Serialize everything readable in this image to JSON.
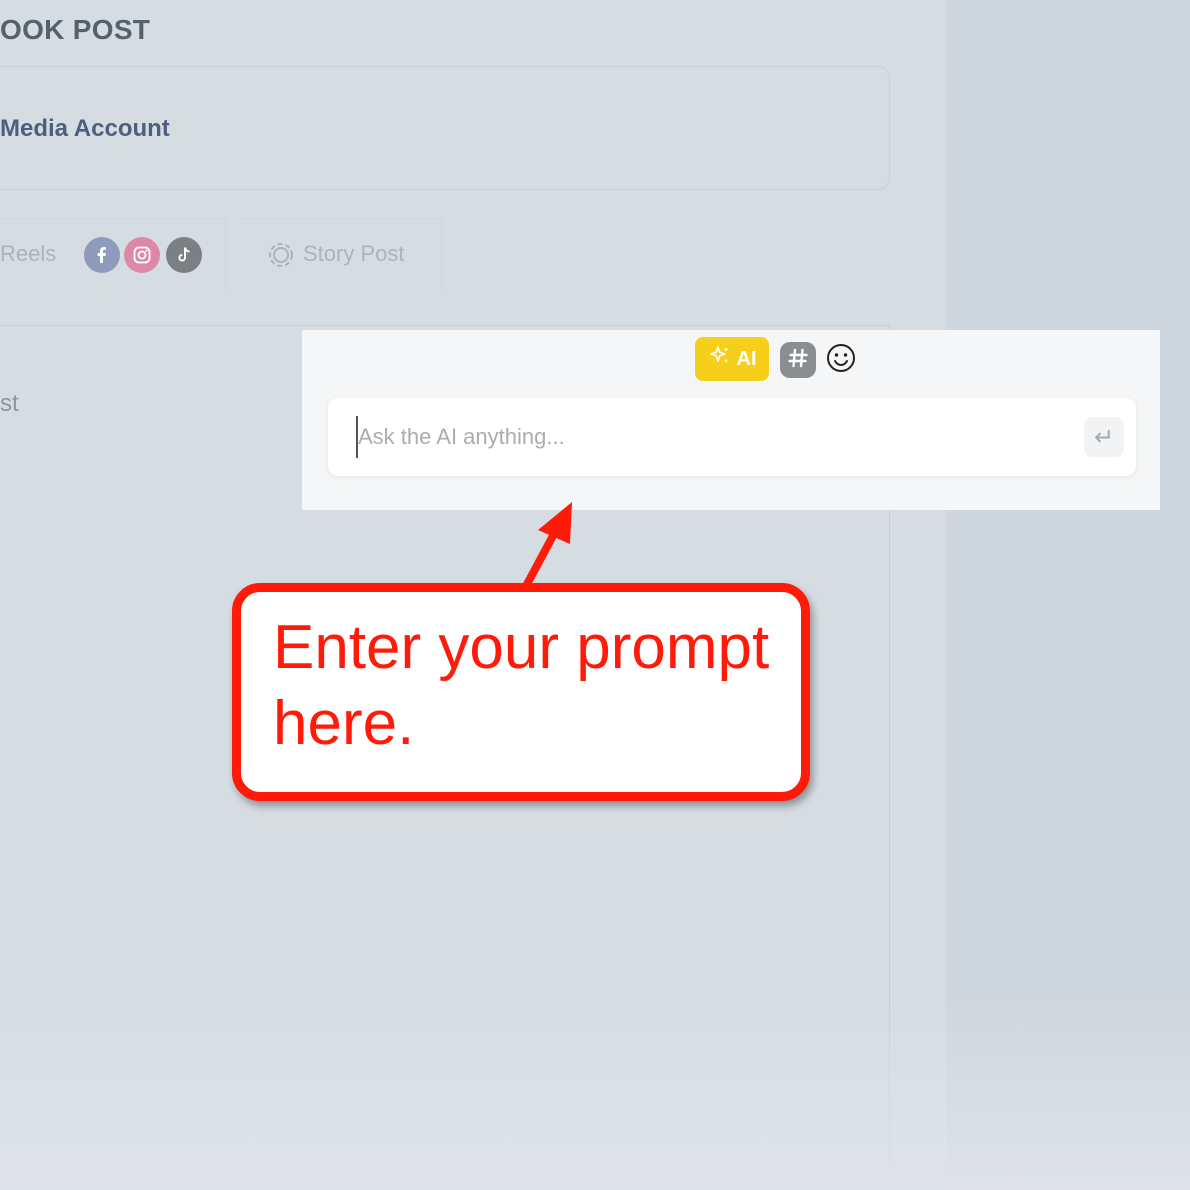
{
  "header": {
    "title": "OOK POST"
  },
  "account": {
    "label": "Media Account"
  },
  "tabs": {
    "reels_label": "Reels",
    "reels_icons": [
      "facebook-icon",
      "instagram-icon",
      "tiktok-icon"
    ],
    "story_label": "Story Post"
  },
  "content": {
    "partial_text": "st"
  },
  "ai_popup": {
    "ai_button_label": "AI",
    "prompt_placeholder": "Ask the AI anything...",
    "prompt_value": "",
    "send_icon": "↵"
  },
  "callout": {
    "text": "Enter your prompt here."
  },
  "colors": {
    "ai_button": "#f5cf1a",
    "callout_red": "#ff1a0a",
    "background": "#d6dde2"
  }
}
